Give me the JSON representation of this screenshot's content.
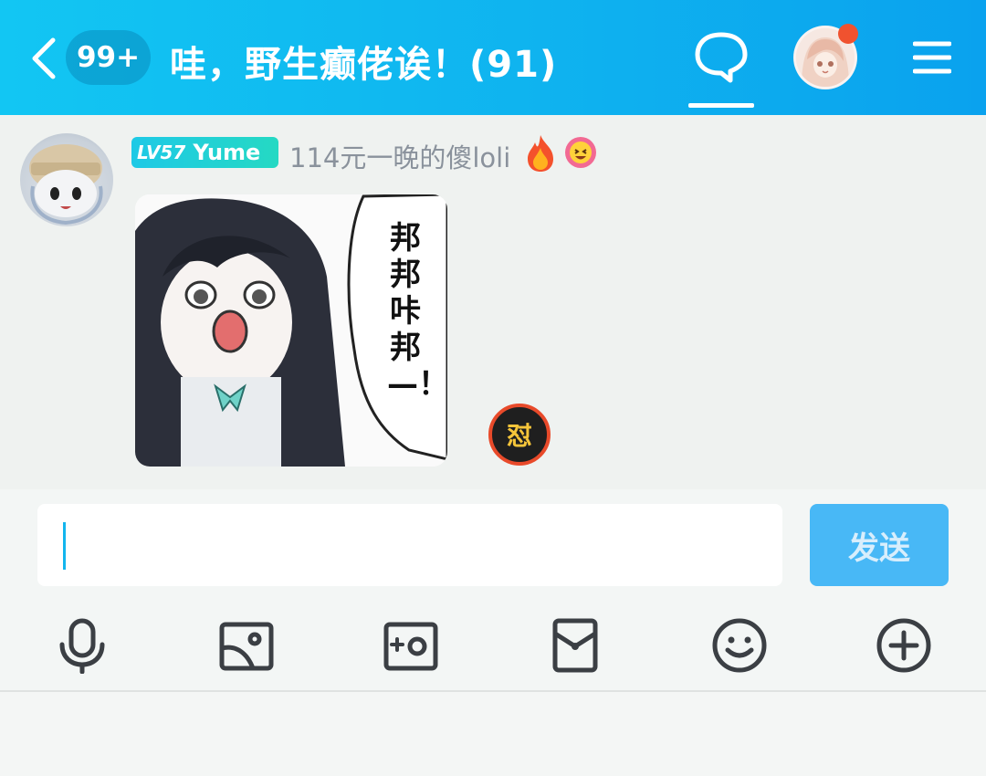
{
  "header": {
    "unread_count": "99+",
    "group_title": "哇，野生癫佬诶！(91)",
    "notification_dot_color": "#f0522f",
    "icons": [
      "back-arrow-icon",
      "chat-bubble-icon",
      "menu-icon"
    ]
  },
  "message": {
    "level_badge": {
      "level_text": "LV57",
      "name": "Yume",
      "color": "#25d9c3"
    },
    "nickname": "114元一晚的傻loli",
    "emoji_icons": [
      "flame-icon",
      "grinning-face-icon"
    ],
    "sticker": {
      "text": "邦邦咔邦—！"
    },
    "reaction_badge": "怼"
  },
  "composer": {
    "input_value": "",
    "send_label": "发送",
    "send_color": "#48b8f6"
  },
  "toolbar": {
    "icons": [
      "microphone-icon",
      "image-icon",
      "camera-icon",
      "red-packet-icon",
      "emoji-icon",
      "plus-icon"
    ]
  }
}
